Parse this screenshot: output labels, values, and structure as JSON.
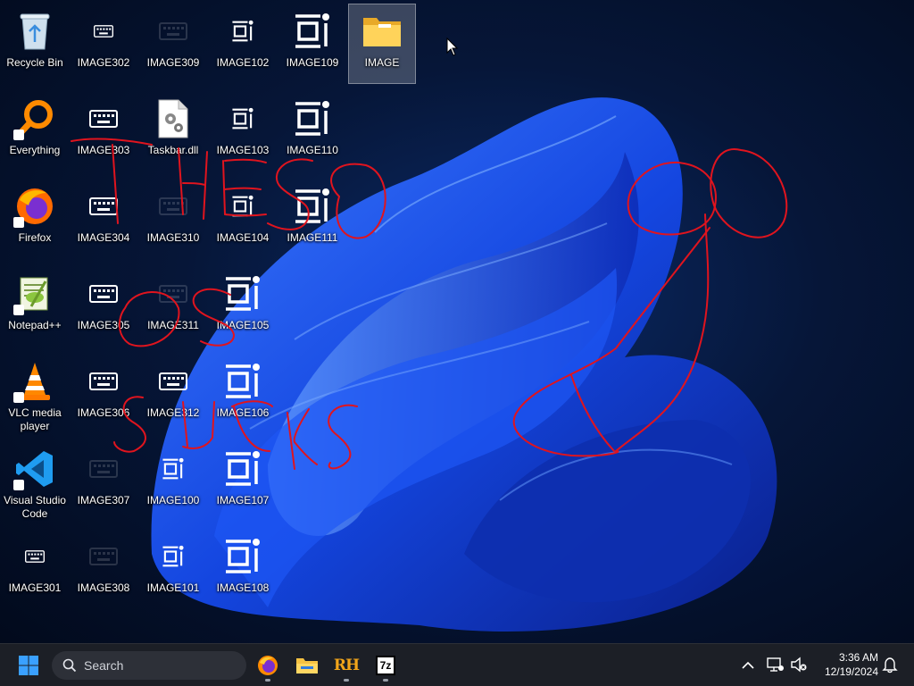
{
  "desktop": {
    "scribble_color": "#e0141e",
    "icons": [
      {
        "label": "Recycle Bin",
        "icon": "recycle-bin-icon"
      },
      {
        "label": "IMAGE302",
        "icon": "keyboard-icon"
      },
      {
        "label": "IMAGE309",
        "icon": "keyboard-icon"
      },
      {
        "label": "IMAGE102",
        "icon": "image-control-icon"
      },
      {
        "label": "IMAGE109",
        "icon": "image-control-icon"
      },
      {
        "label": "IMAGE",
        "icon": "folder-icon"
      },
      {
        "label": "Everything",
        "icon": "magnifier-icon"
      },
      {
        "label": "IMAGE303",
        "icon": "keyboard-icon"
      },
      {
        "label": "Taskbar.dll",
        "icon": "dll-file-icon"
      },
      {
        "label": "IMAGE103",
        "icon": "image-control-icon"
      },
      {
        "label": "IMAGE110",
        "icon": "image-control-icon"
      },
      {
        "label": "Firefox",
        "icon": "firefox-icon"
      },
      {
        "label": "IMAGE304",
        "icon": "keyboard-icon"
      },
      {
        "label": "IMAGE310",
        "icon": "keyboard-icon"
      },
      {
        "label": "IMAGE104",
        "icon": "image-control-icon"
      },
      {
        "label": "IMAGE111",
        "icon": "image-control-icon"
      },
      {
        "label": "Notepad++",
        "icon": "notepad-plus-plus-icon"
      },
      {
        "label": "IMAGE305",
        "icon": "keyboard-icon"
      },
      {
        "label": "IMAGE311",
        "icon": "keyboard-icon"
      },
      {
        "label": "IMAGE105",
        "icon": "image-control-icon"
      },
      {
        "label": "VLC media player",
        "icon": "vlc-cone-icon"
      },
      {
        "label": "IMAGE306",
        "icon": "keyboard-icon"
      },
      {
        "label": "IMAGE312",
        "icon": "keyboard-icon"
      },
      {
        "label": "IMAGE106",
        "icon": "image-control-icon"
      },
      {
        "label": "Visual Studio Code",
        "icon": "vscode-icon"
      },
      {
        "label": "IMAGE307",
        "icon": "keyboard-icon"
      },
      {
        "label": "IMAGE100",
        "icon": "image-control-icon"
      },
      {
        "label": "IMAGE107",
        "icon": "image-control-icon"
      },
      {
        "label": "IMAGE301",
        "icon": "keyboard-icon"
      },
      {
        "label": "IMAGE308",
        "icon": "keyboard-icon"
      },
      {
        "label": "IMAGE101",
        "icon": "image-control-icon"
      },
      {
        "label": "IMAGE108",
        "icon": "image-control-icon"
      }
    ]
  },
  "taskbar": {
    "search_placeholder": "Search",
    "pinned": [
      {
        "icon": "firefox-icon"
      },
      {
        "icon": "file-explorer-icon"
      },
      {
        "icon": "rh-app-icon",
        "text": "RH"
      },
      {
        "icon": "7zip-icon",
        "text": "7z"
      }
    ],
    "clock_time": "3:36 AM",
    "clock_date": "12/19/2024"
  }
}
